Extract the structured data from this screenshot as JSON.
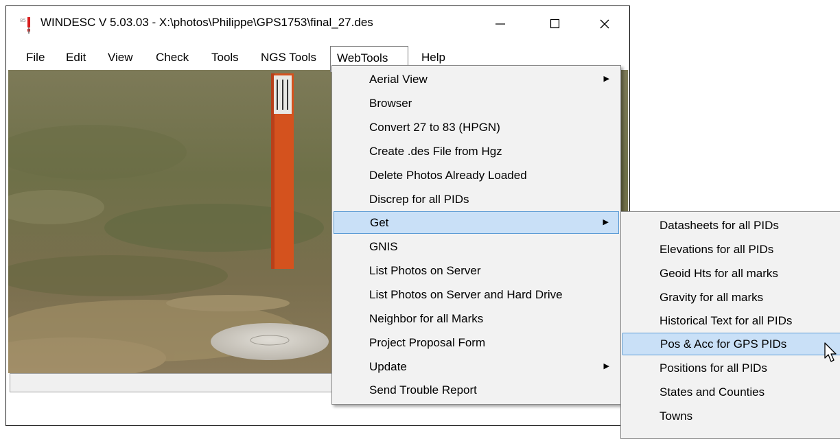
{
  "window": {
    "title": "WINDESC V 5.03.03 - X:\\photos\\Philippe\\GPS1753\\final_27.des",
    "buttons": {
      "minimize": "—",
      "maximize": "☐",
      "close": "✕"
    }
  },
  "menubar": {
    "items": [
      {
        "label": "File"
      },
      {
        "label": "Edit"
      },
      {
        "label": "View"
      },
      {
        "label": "Check"
      },
      {
        "label": "Tools"
      },
      {
        "label": "NGS Tools"
      },
      {
        "label": "WebTools",
        "open": true
      },
      {
        "label": "Help"
      }
    ]
  },
  "webtools_menu": {
    "items": [
      {
        "label": "Aerial View",
        "submenu": true
      },
      {
        "label": "Browser"
      },
      {
        "label": "Convert 27 to 83 (HPGN)"
      },
      {
        "label": "Create .des File from Hgz"
      },
      {
        "label": "Delete Photos Already Loaded"
      },
      {
        "label": "Discrep for all PIDs"
      },
      {
        "label": "Get",
        "submenu": true,
        "highlighted": true
      },
      {
        "label": "GNIS"
      },
      {
        "label": "List Photos on Server"
      },
      {
        "label": "List Photos on Server and Hard Drive"
      },
      {
        "label": "Neighbor for all Marks"
      },
      {
        "label": "Project Proposal Form"
      },
      {
        "label": "Update",
        "submenu": true
      },
      {
        "label": "Send Trouble Report"
      }
    ],
    "submenu_arrow": "▶"
  },
  "get_submenu": {
    "items": [
      {
        "label": "Datasheets for all PIDs"
      },
      {
        "label": "Elevations for all PIDs"
      },
      {
        "label": "Geoid Hts for all marks"
      },
      {
        "label": "Gravity for all marks"
      },
      {
        "label": "Historical Text for all PIDs"
      },
      {
        "label": "Pos & Acc for GPS PIDs",
        "highlighted": true
      },
      {
        "label": "Positions for all PIDs"
      },
      {
        "label": "States and Counties"
      },
      {
        "label": "Towns"
      }
    ]
  },
  "photo": {
    "description_icon": "survey-mark-photo-icon"
  },
  "colors": {
    "highlight": "#c9e0f7",
    "highlight_border": "#5b9bd5",
    "menu_bg": "#f2f2f2",
    "post": "#d4521e"
  }
}
